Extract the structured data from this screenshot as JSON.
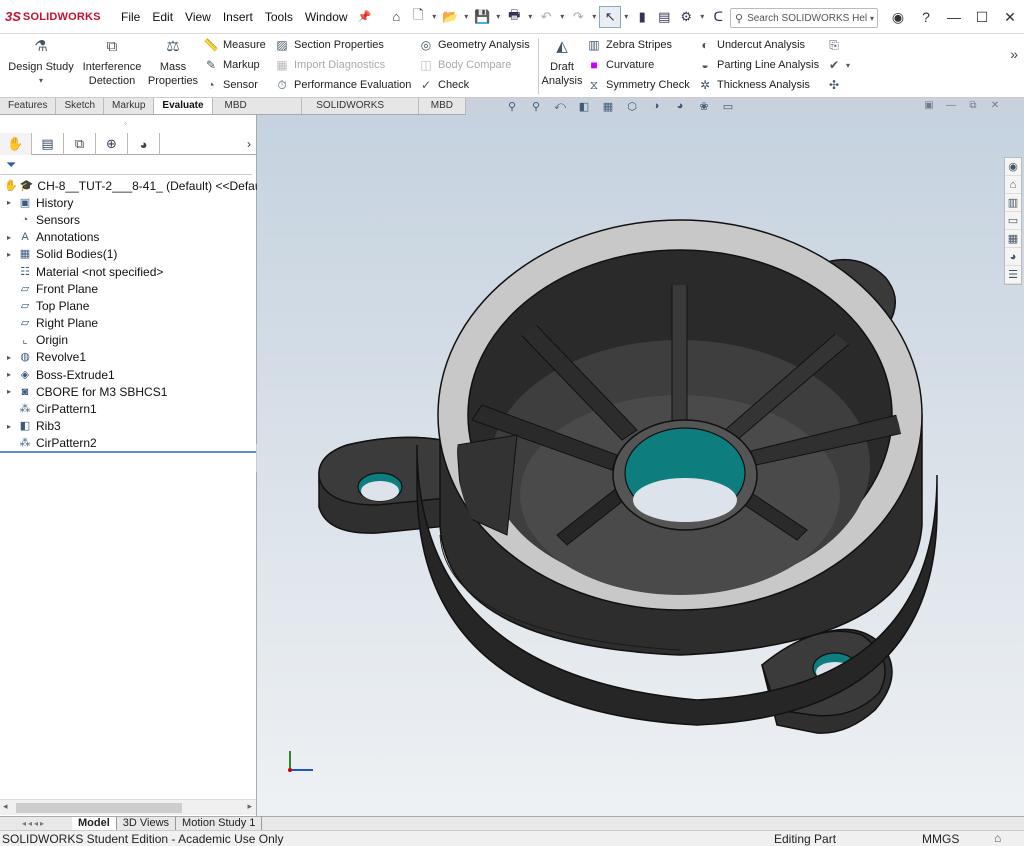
{
  "app": {
    "brand": "SOLIDWORKS",
    "logo_mark": "3S"
  },
  "menu": [
    "File",
    "Edit",
    "View",
    "Insert",
    "Tools",
    "Window"
  ],
  "search": {
    "placeholder": "Search SOLIDWORKS Hel"
  },
  "command_manager": {
    "large_buttons": [
      {
        "label1": "Design Study",
        "label2": "",
        "icon": "design-study-icon"
      },
      {
        "label1": "Interference",
        "label2": "Detection",
        "icon": "interference-icon"
      },
      {
        "label1": "Mass",
        "label2": "Properties",
        "icon": "mass-properties-icon"
      }
    ],
    "col1": [
      {
        "label": "Measure",
        "icon": "measure-icon",
        "enabled": true
      },
      {
        "label": "Markup",
        "icon": "markup-icon",
        "enabled": true
      },
      {
        "label": "Sensor",
        "icon": "sensor-icon",
        "enabled": true
      }
    ],
    "col2": [
      {
        "label": "Section Properties",
        "icon": "section-properties-icon",
        "enabled": true
      },
      {
        "label": "Import Diagnostics",
        "icon": "import-diagnostics-icon",
        "enabled": false
      },
      {
        "label": "Performance Evaluation",
        "icon": "performance-icon",
        "enabled": true
      }
    ],
    "col3": [
      {
        "label": "Geometry Analysis",
        "icon": "geometry-analysis-icon",
        "enabled": true
      },
      {
        "label": "Body Compare",
        "icon": "body-compare-icon",
        "enabled": false
      },
      {
        "label": "Check",
        "icon": "check-icon",
        "enabled": true
      }
    ],
    "draft": {
      "label1": "Draft",
      "label2": "Analysis"
    },
    "col4": [
      {
        "label": "Zebra Stripes",
        "icon": "zebra-icon",
        "enabled": true
      },
      {
        "label": "Curvature",
        "icon": "curvature-icon",
        "enabled": true
      },
      {
        "label": "Symmetry Check",
        "icon": "symmetry-icon",
        "enabled": true
      }
    ],
    "col5": [
      {
        "label": "Undercut Analysis",
        "icon": "undercut-icon",
        "enabled": true
      },
      {
        "label": "Parting Line Analysis",
        "icon": "parting-line-icon",
        "enabled": true
      },
      {
        "label": "Thickness Analysis",
        "icon": "thickness-icon",
        "enabled": true
      }
    ]
  },
  "tabs": [
    "Features",
    "Sketch",
    "Markup",
    "Evaluate",
    "MBD Dimensions",
    "SOLIDWORKS Add-Ins",
    "MBD"
  ],
  "active_tab": "Evaluate",
  "tree": {
    "root": "CH-8__TUT-2___8-41_ (Default) <<Defau",
    "items": [
      {
        "label": "History",
        "icon": "history-icon",
        "expandable": true
      },
      {
        "label": "Sensors",
        "icon": "sensors-icon",
        "expandable": false
      },
      {
        "label": "Annotations",
        "icon": "annotations-icon",
        "expandable": true
      },
      {
        "label": "Solid Bodies(1)",
        "icon": "solid-bodies-icon",
        "expandable": true
      },
      {
        "label": "Material <not specified>",
        "icon": "material-icon",
        "expandable": false
      },
      {
        "label": "Front Plane",
        "icon": "plane-icon",
        "expandable": false
      },
      {
        "label": "Top Plane",
        "icon": "plane-icon",
        "expandable": false
      },
      {
        "label": "Right Plane",
        "icon": "plane-icon",
        "expandable": false
      },
      {
        "label": "Origin",
        "icon": "origin-icon",
        "expandable": false
      },
      {
        "label": "Revolve1",
        "icon": "revolve-icon",
        "expandable": true
      },
      {
        "label": "Boss-Extrude1",
        "icon": "extrude-icon",
        "expandable": true
      },
      {
        "label": "CBORE for M3 SBHCS1",
        "icon": "hole-icon",
        "expandable": true
      },
      {
        "label": "CirPattern1",
        "icon": "pattern-icon",
        "expandable": false
      },
      {
        "label": "Rib3",
        "icon": "rib-icon",
        "expandable": true
      },
      {
        "label": "CirPattern2",
        "icon": "pattern-icon",
        "expandable": false
      }
    ]
  },
  "bottom_tabs": [
    "Model",
    "3D Views",
    "Motion Study 1"
  ],
  "active_bottom_tab": "Model",
  "status": {
    "left": "SOLIDWORKS Student Edition - Academic Use Only",
    "mode": "Editing Part",
    "units": "MMGS"
  },
  "colors": {
    "brand": "#c8102e",
    "teal": "#0e7d7d",
    "body": "#2f2f2f",
    "face": "#c8c8c8"
  }
}
